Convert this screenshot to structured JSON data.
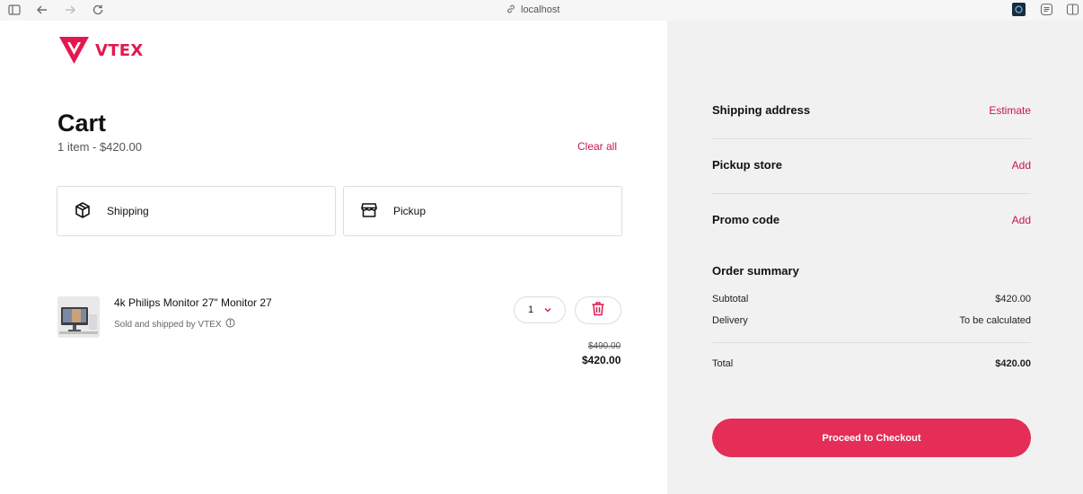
{
  "browser": {
    "url": "localhost"
  },
  "brand": {
    "name": "VTEX",
    "accent": "#e3184f"
  },
  "cart": {
    "title": "Cart",
    "subtitle": "1 item - $420.00",
    "clear_all": "Clear all",
    "delivery_options": [
      {
        "label": "Shipping",
        "icon": "box-icon"
      },
      {
        "label": "Pickup",
        "icon": "store-icon"
      }
    ],
    "items": [
      {
        "name": "4k Philips Monitor 27\" Monitor 27",
        "seller": "Sold and shipped by VTEX",
        "quantity": "1",
        "list_price": "$490.00",
        "price": "$420.00"
      }
    ]
  },
  "sidebar": {
    "shipping_address": {
      "label": "Shipping address",
      "action": "Estimate"
    },
    "pickup_store": {
      "label": "Pickup store",
      "action": "Add"
    },
    "promo_code": {
      "label": "Promo code",
      "action": "Add"
    },
    "summary": {
      "title": "Order summary",
      "subtotal_label": "Subtotal",
      "subtotal_value": "$420.00",
      "delivery_label": "Delivery",
      "delivery_value": "To be calculated",
      "total_label": "Total",
      "total_value": "$420.00"
    },
    "checkout_label": "Proceed to Checkout",
    "checkout_color": "#e42d57"
  }
}
